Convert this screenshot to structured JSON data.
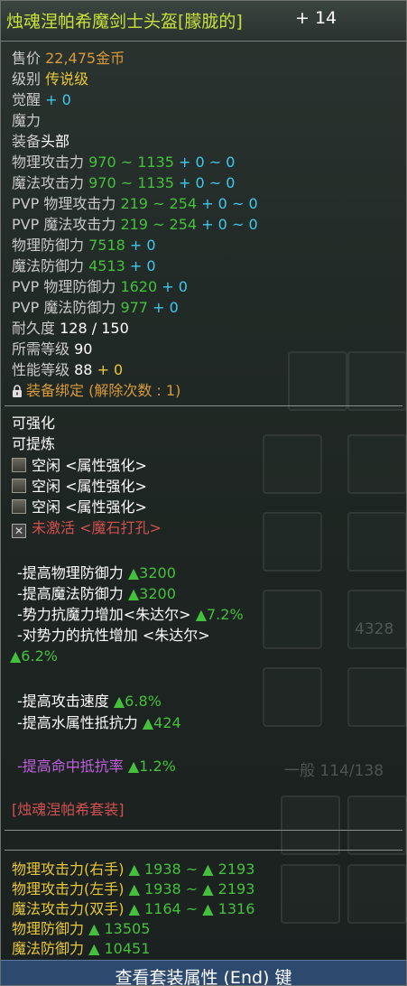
{
  "item": {
    "name": "烛魂涅帕希魔剑士头盔[朦胧的]",
    "plus": "+ 14"
  },
  "stats": {
    "price_label": "售价",
    "price_value": "22,475",
    "price_unit": "金币",
    "grade_label": "级别",
    "grade_value": "传说级",
    "awaken_label": "觉醒",
    "awaken_value": "+ 0",
    "magic_label": "魔力",
    "equip_label": "装备",
    "equip_value": "头部",
    "phys_atk_label": "物理攻击力",
    "phys_atk_value": "970 ~ 1135",
    "phys_atk_bonus": "+ 0 ~ 0",
    "mag_atk_label": "魔法攻击力",
    "mag_atk_value": "970 ~ 1135",
    "mag_atk_bonus": "+ 0 ~ 0",
    "pvp_phys_atk_label": "PVP 物理攻击力",
    "pvp_phys_atk_value": "219 ~ 254",
    "pvp_phys_atk_bonus": "+ 0 ~ 0",
    "pvp_mag_atk_label": "PVP 魔法攻击力",
    "pvp_mag_atk_value": "219 ~ 254",
    "pvp_mag_atk_bonus": "+ 0 ~ 0",
    "phys_def_label": "物理防御力",
    "phys_def_value": "7518",
    "phys_def_bonus": "+ 0",
    "mag_def_label": "魔法防御力",
    "mag_def_value": "4513",
    "mag_def_bonus": "+ 0",
    "pvp_phys_def_label": "PVP 物理防御力",
    "pvp_phys_def_value": "1620",
    "pvp_phys_def_bonus": "+ 0",
    "pvp_mag_def_label": "PVP 魔法防御力",
    "pvp_mag_def_value": "977",
    "pvp_mag_def_bonus": "+ 0",
    "durability_label": "耐久度",
    "durability_value": "128 / 150",
    "req_level_label": "所需等级",
    "req_level_value": "90",
    "perf_level_label": "性能等级",
    "perf_level_value": "88",
    "perf_level_bonus": "+ 0",
    "bind_text": "装备绑定 (解除次数 : 1)"
  },
  "enhance": {
    "can_enhance": "可强化",
    "can_refine": "可提炼",
    "slots": [
      {
        "text": "空闲 <属性强化>"
      },
      {
        "text": "空闲 <属性强化>"
      },
      {
        "text": "空闲 <属性强化>"
      }
    ],
    "socket_text": "未激活 <魔石打孔>"
  },
  "bonuses": {
    "b1_label": "-提高物理防御力",
    "b1_value": "▲3200",
    "b2_label": "-提高魔法防御力",
    "b2_value": "▲3200",
    "b3_label": "-势力抗魔力增加<朱达尔>",
    "b3_value": "▲7.2%",
    "b4_label": "-对势力的抗性增加 <朱达尔>",
    "b4_value": "▲6.2%",
    "b5_label": "-提高攻击速度",
    "b5_value": "▲6.8%",
    "b6_label": "-提高水属性抵抗力",
    "b6_value": "▲424",
    "b7_label": "-提高命中抵抗率",
    "b7_value": "▲1.2%"
  },
  "set": {
    "name": "[烛魂涅帕希套装]",
    "s1_label": "物理攻击力(右手)",
    "s1_value": "▲ 1938 ~ ▲ 2193",
    "s2_label": "物理攻击力(左手)",
    "s2_value": "▲ 1938 ~ ▲ 2193",
    "s3_label": "魔法攻击力(双手)",
    "s3_value": "▲ 1164 ~ ▲ 1316",
    "s4_label": "物理防御力",
    "s4_value": "▲ 13505",
    "s5_label": "魔法防御力",
    "s5_value": "▲ 10451"
  },
  "footer": {
    "text": "查看套装属性 (End) 键"
  },
  "background": {
    "label1": "一般 114/138",
    "label2": "4328"
  },
  "icons": {
    "lock": "lock-icon",
    "slot": "empty-slot-icon",
    "socket": "socket-locked-icon"
  }
}
